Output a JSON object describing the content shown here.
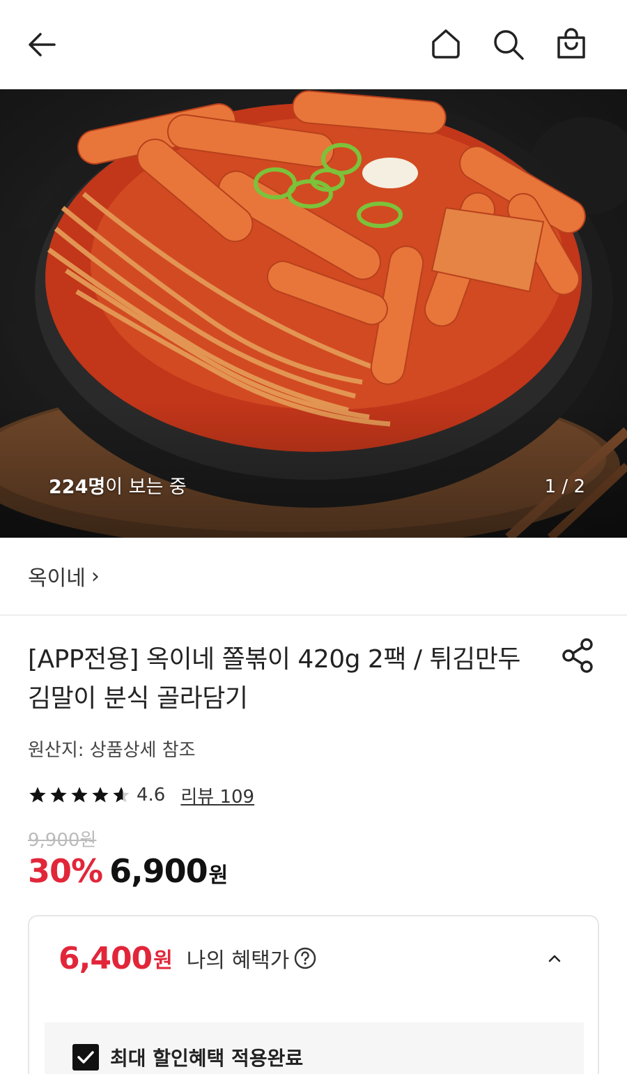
{
  "header": {
    "back_icon": "back-arrow-icon",
    "home_icon": "home-icon",
    "search_icon": "search-icon",
    "cart_icon": "shopping-bag-icon"
  },
  "hero": {
    "viewers_count": "224명",
    "viewers_text": "이 보는 중",
    "pager": "1 / 2"
  },
  "brand": {
    "name": "옥이네",
    "chevron": "›"
  },
  "product": {
    "title": "[APP전용] 옥이네 쫄볶이 420g 2팩 / 튀김만두 김말이 분식 골라담기",
    "origin": "원산지: 상품상세 참조",
    "rating": "4.6",
    "reviews": "리뷰 109",
    "rating_stars": 4.6,
    "original_price": "9,900원",
    "discount": "30%",
    "price": "6,900",
    "currency": "원"
  },
  "benefit": {
    "price": "6,400",
    "currency": "원",
    "label": "나의 혜택가",
    "help_icon": "question-circle-icon",
    "collapse_icon": "chevron-up-icon",
    "checked": true,
    "check_label": "최대 할인혜택 적용완료"
  },
  "colors": {
    "accent_red": "#e2263a",
    "text_dark": "#222222"
  }
}
